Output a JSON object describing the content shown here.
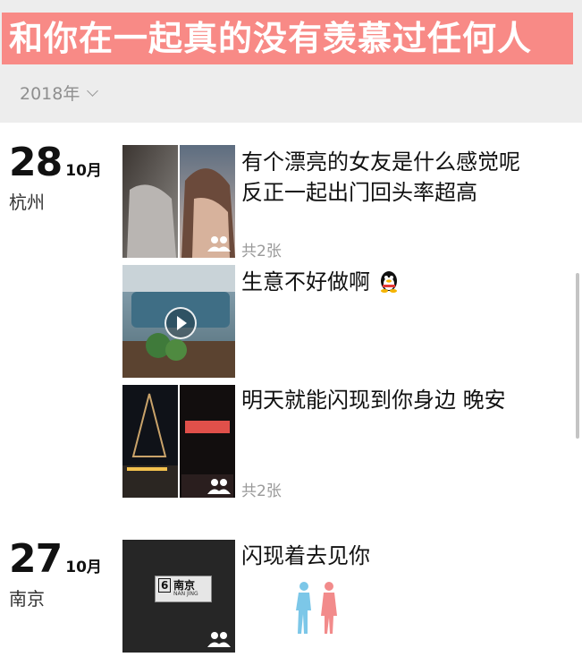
{
  "banner": {
    "text": "和你在一起真的没有羡慕过任何人",
    "color": "#f88a86"
  },
  "year_selector": {
    "label": "2018年"
  },
  "entries": [
    {
      "day": "28",
      "month": "10月",
      "city": "杭州",
      "posts": [
        {
          "text_lines": [
            "有个漂亮的女友是什么感觉呢",
            "反正一起出门回头率超高"
          ],
          "count": "共2张",
          "icon": "two-people-icon"
        },
        {
          "text": "生意不好做啊",
          "emoji": "qq-penguin-icon",
          "media": "video",
          "icon": "play-icon"
        },
        {
          "text": "明天就能闪现到你身边 晚安",
          "count": "共2张",
          "icon": "two-people-icon"
        }
      ]
    },
    {
      "day": "27",
      "month": "10月",
      "city": "南京",
      "posts": [
        {
          "text": "闪现着去见你",
          "sign_text": "南京",
          "sign_number": "6",
          "sign_sub": "NAN JING",
          "icon": "two-people-icon"
        }
      ]
    }
  ],
  "colors": {
    "background": "#ffffff",
    "header_bg": "#ededed",
    "muted_text": "#9a9a9a",
    "couple_blue": "#7cc7e8",
    "couple_pink": "#f28b8b"
  }
}
